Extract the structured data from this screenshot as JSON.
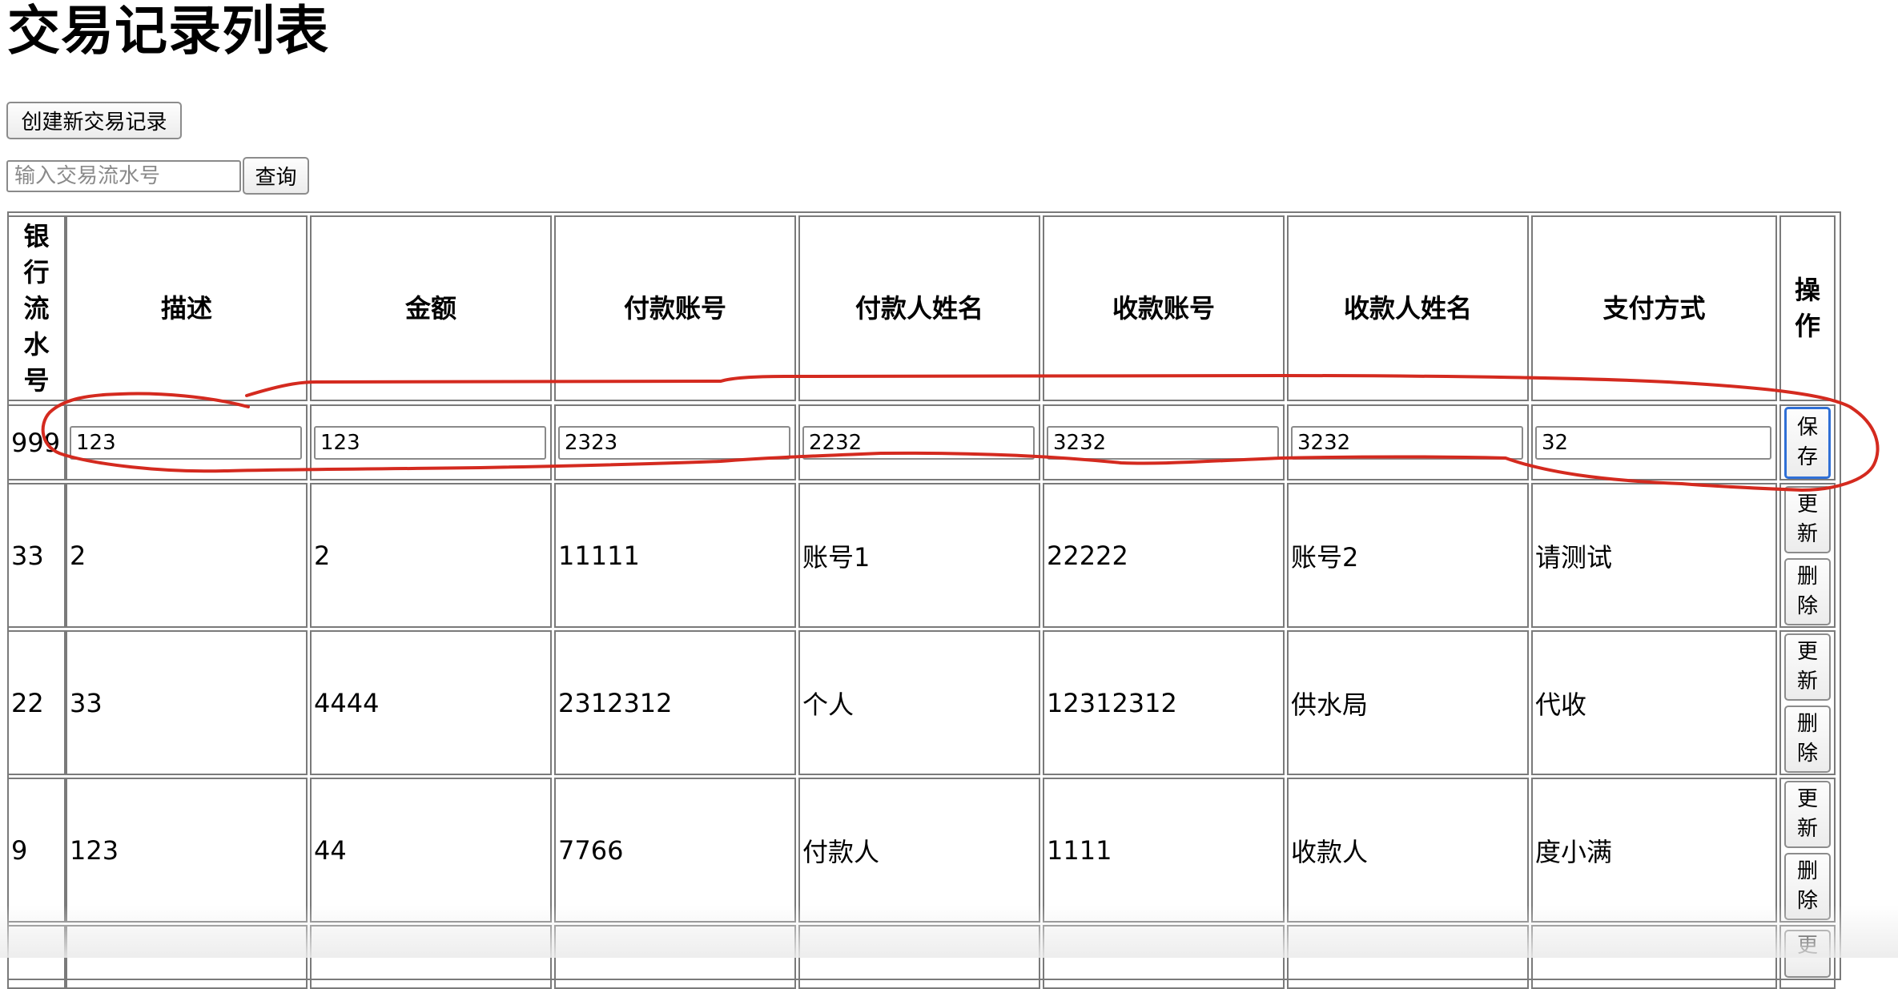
{
  "page": {
    "title": "交易记录列表"
  },
  "toolbar": {
    "create_label": "创建新交易记录",
    "search_placeholder": "输入交易流水号",
    "search_value": "",
    "query_label": "查询"
  },
  "table": {
    "headers": [
      "银行流水号",
      "描述",
      "金额",
      "付款账号",
      "付款人姓名",
      "收款账号",
      "收款人姓名",
      "支付方式",
      "操作"
    ],
    "edit_row": {
      "id": "999",
      "values": [
        "123",
        "123",
        "2323",
        "2232",
        "3232",
        "3232",
        "32"
      ],
      "save_label": "保存"
    },
    "rows": [
      {
        "cells": [
          "33",
          "2",
          "2",
          "11111",
          "账号1",
          "22222",
          "账号2",
          "请测试"
        ]
      },
      {
        "cells": [
          "22",
          "33",
          "4444",
          "2312312",
          "个人",
          "12312312",
          "供水局",
          "代收"
        ]
      },
      {
        "cells": [
          "9",
          "123",
          "44",
          "7766",
          "付款人",
          "1111",
          "收款人",
          "度小满"
        ]
      }
    ],
    "update_label": "更新",
    "delete_label": "删除",
    "partial_row_button": "更"
  },
  "annotation": {
    "color": "#d42a1f"
  }
}
